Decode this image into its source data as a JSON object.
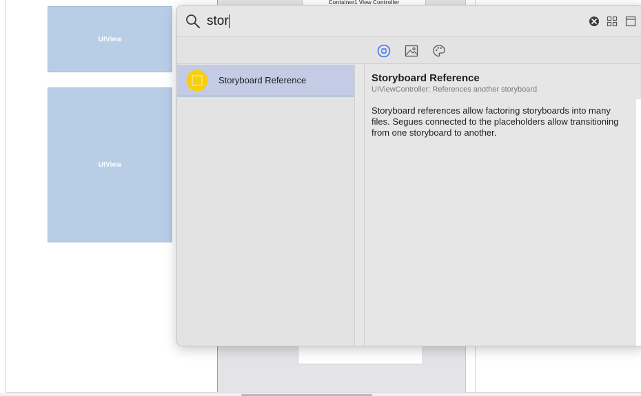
{
  "canvas": {
    "uiview_1_label": "UIView",
    "uiview_2_label": "UIView",
    "scene_title": "Container1 View Controller"
  },
  "library": {
    "search": {
      "value": "stor",
      "icon": "magnifying-glass-icon"
    },
    "toolbar_icons": [
      "clear-icon",
      "grid-view-icon",
      "panel-view-icon"
    ],
    "filter_tabs": [
      {
        "name": "objects-library-icon",
        "selected": true
      },
      {
        "name": "media-library-icon",
        "selected": false
      },
      {
        "name": "color-library-icon",
        "selected": false
      }
    ],
    "results": [
      {
        "label": "Storyboard Reference",
        "icon": "storyboard-reference-icon",
        "selected": true
      }
    ],
    "detail": {
      "title": "Storyboard Reference",
      "subtitle": "UIViewController: References another storyboard",
      "description": "Storyboard references allow factoring storyboards into many files. Segues connected to the placeholders allow transitioning from one storyboard to another."
    }
  },
  "colors": {
    "selection_bg": "#c3cce4",
    "selection_border": "#6f8fd4",
    "accent_blue": "#3a78f2",
    "uiview_fill": "#b8cde6",
    "storyboard_icon_yellow": "#f6cf12"
  }
}
